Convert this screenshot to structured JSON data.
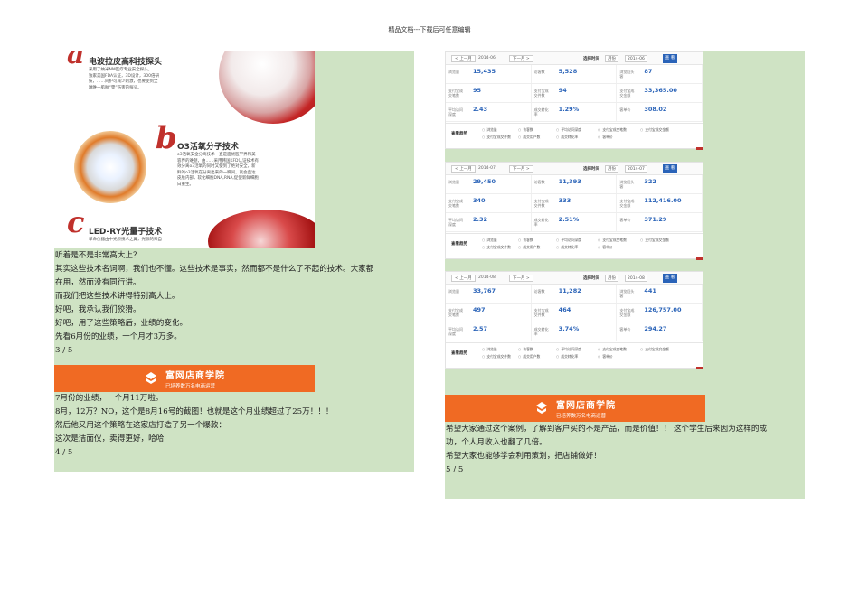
{
  "header": {
    "note": "精品文档---下载后可任意编辑"
  },
  "product": {
    "features": [
      {
        "letter": "a",
        "title": "电波拉皮高科技探头",
        "desc": [
          "采用了纳米NM医疗专业安全探头，",
          "独家美国FDA认证，3D设计，300倍研",
          "技，……同护可减少刺激，也要使到全",
          "球唯一肌肤“零”伤害的探头。"
        ]
      },
      {
        "letter": "b",
        "title": "O3活氧分子技术",
        "desc": [
          "o3活氧安全分离技术一直是面优医学界和美",
          "容界的难题，由……采用韩国KFD认证技术有",
          "效分离o3活氧的同时又使到了绝对安全，新",
          "鲜的o3活氧在分离出来的一瞬间，就会直达",
          "皮肤内部，软化细胞DNA,RNA,促使新鲜细胞",
          "白重生。"
        ]
      },
      {
        "letter": "c",
        "title": "LED-RY光量子技术",
        "desc": [
          "革命仪器由中光原技术之翼，光源的来自"
        ]
      }
    ]
  },
  "left_text": [
    "听着是不是非常高大上？",
    "其实这些技术名词啊，我们也不懂。这些技术是事实，然而都不是什么了不起的技术。大家都",
    "在用，然而没有同行讲。",
    "而我们把这些技术讲得特别高大上。",
    "好吧，我承认我们狡猾。",
    "好吧，用了这些策略后，业绩的变化。",
    "先看6月份的业绩，一个月才3万多。",
    "3 / 5"
  ],
  "banner": {
    "title": "富网店商学院",
    "subtitle": "已培养数万名电商运营"
  },
  "left_text2": [
    "7月份的业绩，一个月11万啦。",
    "8月，12万？NO，这个是8月16号的截图！也就是这个月业绩超过了25万！！！",
    "然后他又用这个策略在这家店打造了另一个爆款：",
    "这次是洁面仪，卖得更好，哈哈",
    "4 / 5"
  ],
  "right_text": [
    "希望大家通过这个案例，了解到客户买的不是产品，而是价值！！ 这个学生后来因为这样的成",
    "功，个人月收入也翻了几倍。",
    "希望大家也能够学会利用策划，把店铺做好！",
    "5 / 5"
  ],
  "stats_common": {
    "prev": "< 上一月",
    "next": "下一月 >",
    "select_time": "选择时间",
    "select_mode": "月份",
    "query": "查 看",
    "trend": "查看趋势",
    "labels": [
      "浏览量",
      "访客数",
      "浏览回头客",
      "支付宝成交笔数",
      "支付宝成交件数",
      "支付宝成交金额",
      "平均访问深度",
      "成交转化率",
      "客单价"
    ],
    "options": [
      "浏览量",
      "访客数",
      "平均访问深度",
      "支付宝成交笔数",
      "支付宝成交金额",
      "支付宝成交件数",
      "成交用户数",
      "成交转化率",
      "客单价"
    ]
  },
  "stats": [
    {
      "period": "2014-06",
      "selected": "2014-06",
      "values": [
        "15,435",
        "5,528",
        "87",
        "95",
        "94",
        "33,365.00",
        "2.43",
        "1.29%",
        "308.02"
      ]
    },
    {
      "period": "2014-07",
      "selected": "2014-07",
      "values": [
        "29,450",
        "11,393",
        "322",
        "340",
        "333",
        "112,416.00",
        "2.32",
        "2.51%",
        "371.29"
      ]
    },
    {
      "period": "2014-08",
      "selected": "2014-08",
      "values": [
        "33,767",
        "11,282",
        "441",
        "497",
        "464",
        "126,757.00",
        "2.57",
        "3.74%",
        "294.27"
      ]
    }
  ]
}
